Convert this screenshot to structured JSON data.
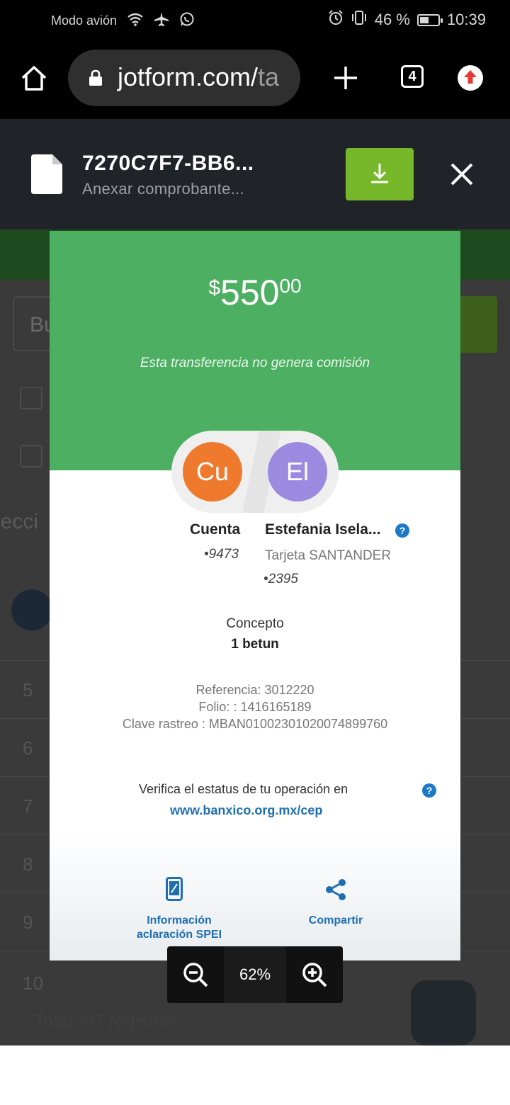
{
  "status_bar": {
    "airplane_text": "Modo avión",
    "battery": "46 %",
    "time": "10:39",
    "icons": [
      "wifi-icon",
      "airplane-icon",
      "whatsapp-icon",
      "alarm-icon",
      "vibrate-icon",
      "battery-icon"
    ]
  },
  "browser": {
    "url_main": "jotform.com/",
    "url_cut": "ta",
    "tab_count": "4"
  },
  "file_header": {
    "file_name": "7270C7F7-BB6...",
    "subtitle": "Anexar comprobante..."
  },
  "background_page": {
    "search_placeholder": "Bu",
    "selecc_text": "lecci",
    "rows": [
      "5",
      "6",
      "7",
      "8",
      "9",
      "10"
    ],
    "total": "Total: 97 registros"
  },
  "receipt": {
    "currency": "$",
    "amount": "550",
    "cents": "00",
    "fee_note": "Esta transferencia no genera comisión",
    "from_initials": "Cu",
    "to_initials": "El",
    "from_name": "Cuenta",
    "from_account": "•9473",
    "to_name": "Estefania Isela...",
    "to_bank": "Tarjeta SANTANDER",
    "to_account": "•2395",
    "concept_label": "Concepto",
    "concept_value": "1 betun",
    "reference": "Referencia: 3012220",
    "folio": "Folio: : 1416165189",
    "tracking": "Clave rastreo : MBAN01002301020074899760",
    "verify_text": "Verifica el estatus de tu operación en",
    "verify_link": "www.banxico.org.mx/cep",
    "action_info_line1": "Información",
    "action_info_line2": "aclaración SPEI",
    "action_share": "Compartir"
  },
  "zoom": {
    "level": "62%"
  },
  "colors": {
    "receipt_green": "#4caf62",
    "download_green": "#76b82a",
    "avatar_orange": "#ef7a2d",
    "avatar_purple": "#9b8be0",
    "link_blue": "#1f6fb0"
  }
}
